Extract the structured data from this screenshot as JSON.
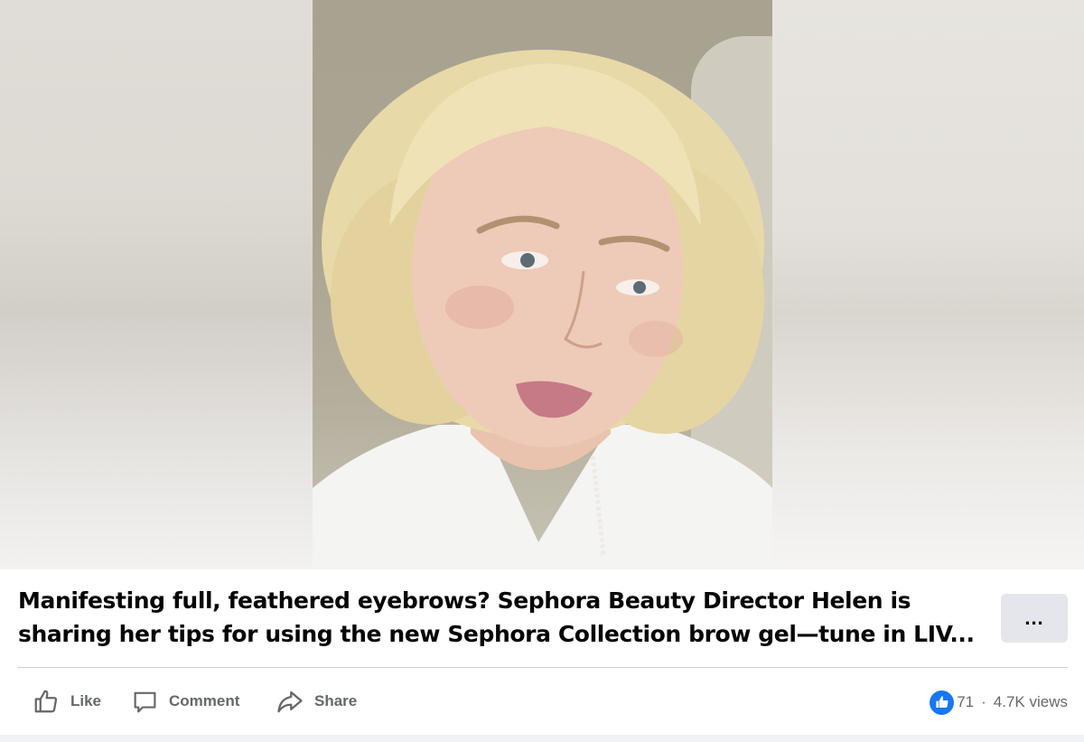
{
  "post": {
    "caption": "Manifesting full, feathered eyebrows? Sephora Beauty Director Helen is sharing her tips for using the new Sephora Collection brow gel—tune in LIV...",
    "more_label": "...",
    "actions": {
      "like_label": "Like",
      "comment_label": "Comment",
      "share_label": "Share"
    },
    "stats": {
      "reactions": "71",
      "separator": "·",
      "views": "4.7K views"
    }
  },
  "colors": {
    "accent": "#1877f2",
    "muted_text": "#65676b",
    "more_button_bg": "#e4e6eb"
  }
}
